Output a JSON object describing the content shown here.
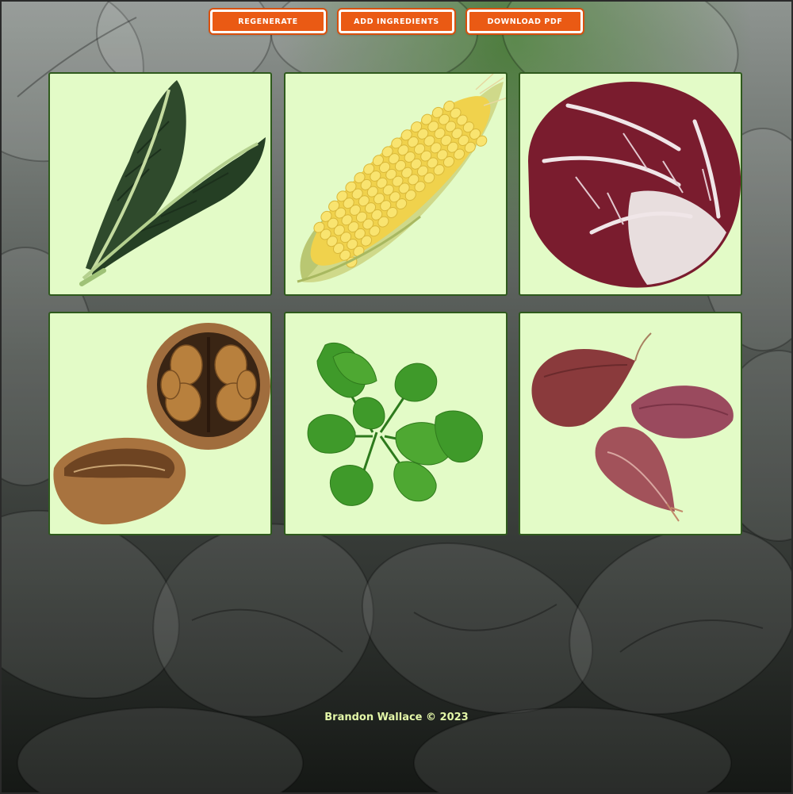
{
  "toolbar": {
    "regenerate_label": "REGENERATE",
    "add_ingredients_label": "ADD INGREDIENTS",
    "download_pdf_label": "DOWNLOAD PDF"
  },
  "ingredients": [
    {
      "icon": "kale-icon"
    },
    {
      "icon": "corn-icon"
    },
    {
      "icon": "radicchio-icon"
    },
    {
      "icon": "walnut-icon"
    },
    {
      "icon": "parsley-icon"
    },
    {
      "icon": "shallot-icon"
    }
  ],
  "footer": {
    "credit": "Brandon Wallace © 2023"
  },
  "colors": {
    "button": "#ea5a14",
    "card_background": "#e3fbc7",
    "card_border": "#2f5a1d",
    "footer_text": "#e4f7a8"
  }
}
